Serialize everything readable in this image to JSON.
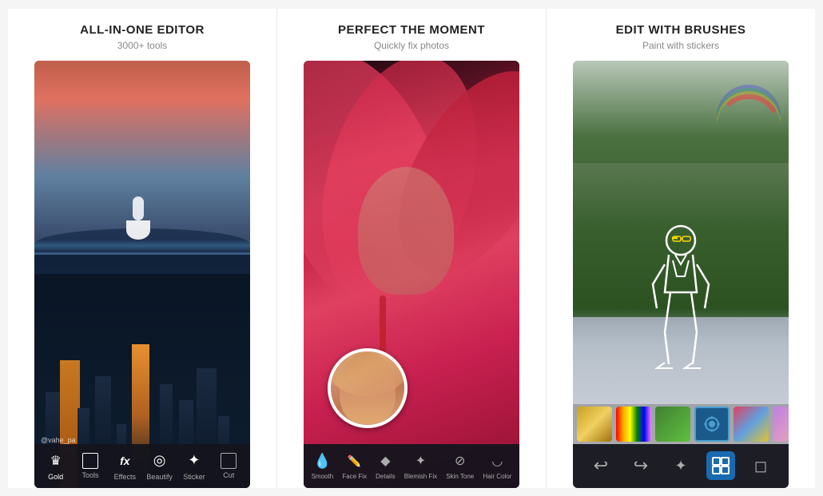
{
  "panels": [
    {
      "id": "panel1",
      "title": "ALL-IN-ONE EDITOR",
      "subtitle": "3000+ tools",
      "watermark": "@vahe_pa",
      "toolbar": {
        "items": [
          {
            "icon": "♛",
            "label": "Gold"
          },
          {
            "icon": "⊞",
            "label": "Tools"
          },
          {
            "icon": "fx",
            "label": "Effects"
          },
          {
            "icon": "◉",
            "label": "Beautify"
          },
          {
            "icon": "✦",
            "label": "Sticker"
          },
          {
            "icon": "⊡",
            "label": "Cut"
          }
        ]
      }
    },
    {
      "id": "panel2",
      "title": "PERFECT THE MOMENT",
      "subtitle": "Quickly fix photos",
      "toolbar": {
        "items": [
          {
            "icon": "💧",
            "label": "Smooth"
          },
          {
            "icon": "✏",
            "label": "Face Fix"
          },
          {
            "icon": "◆",
            "label": "Details"
          },
          {
            "icon": "✦",
            "label": "Blemish Fix"
          },
          {
            "icon": "⊘",
            "label": "Skin Tone"
          },
          {
            "icon": "◡",
            "label": "Hair Color"
          }
        ]
      }
    },
    {
      "id": "panel3",
      "title": "EDIT With BRUSHES",
      "subtitle": "Paint with stickers",
      "toolbar": {
        "items": [
          {
            "icon": "↩",
            "label": "",
            "active": false
          },
          {
            "icon": "↪",
            "label": "",
            "active": false
          },
          {
            "icon": "✦",
            "label": "",
            "active": false
          },
          {
            "icon": "⊞",
            "label": "",
            "active": true
          },
          {
            "icon": "◻",
            "label": "",
            "active": false
          }
        ]
      }
    }
  ]
}
